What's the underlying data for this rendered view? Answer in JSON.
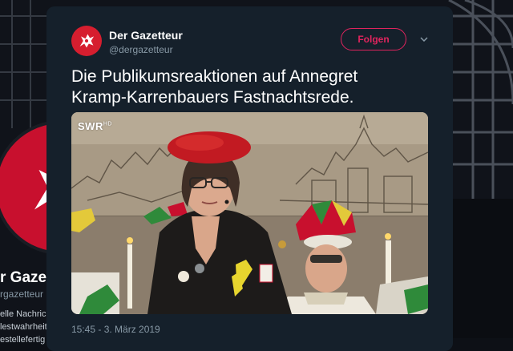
{
  "background_profile": {
    "name": "r Gazett",
    "handle": "rgazetteur",
    "bio_lines": [
      "elle Nachrich",
      "lestwahrheit",
      "estellefertig"
    ]
  },
  "tweet": {
    "author_name": "Der Gazetteur",
    "author_handle": "@dergazetteur",
    "follow_label": "Folgen",
    "text_lines": [
      "Die Publikumsreaktionen auf Annegret",
      "Kramp-Karrenbauers Fastnachtsrede."
    ],
    "media": {
      "overlay_logo": "SWR",
      "overlay_logo_suffix": "HD"
    },
    "timestamp": "15:45 - 3. März 2019"
  },
  "colors": {
    "modal_bg": "#15202b",
    "brand_red": "#d61e2f",
    "follow_accent": "#e0245e",
    "muted_text": "#8899a6"
  },
  "icons": [
    "gazetteur-dragon-logo",
    "chevron-down-icon"
  ]
}
